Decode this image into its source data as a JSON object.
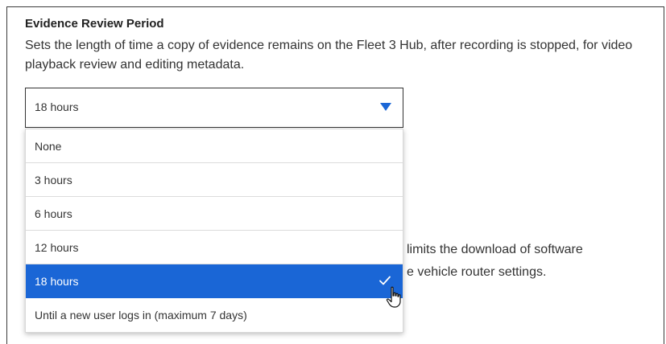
{
  "section": {
    "title": "Evidence Review Period",
    "description": "Sets the length of time a copy of evidence remains on the Fleet 3 Hub, after recording is stopped, for video playback review and editing metadata."
  },
  "select": {
    "value": "18 hours",
    "arrow_icon": "triangle-down-icon",
    "accent_color": "#1a66d6"
  },
  "dropdown": {
    "options": [
      {
        "label": "None"
      },
      {
        "label": "3 hours"
      },
      {
        "label": "6 hours"
      },
      {
        "label": "12 hours"
      },
      {
        "label": "18 hours",
        "selected": true
      },
      {
        "label": "Until a new user logs in (maximum 7 days)"
      }
    ],
    "selected_icon": "check-icon"
  },
  "obscured_text": {
    "line1": "limits the download of software",
    "line2": "e vehicle router settings."
  },
  "cursor": "hand-pointer-icon"
}
